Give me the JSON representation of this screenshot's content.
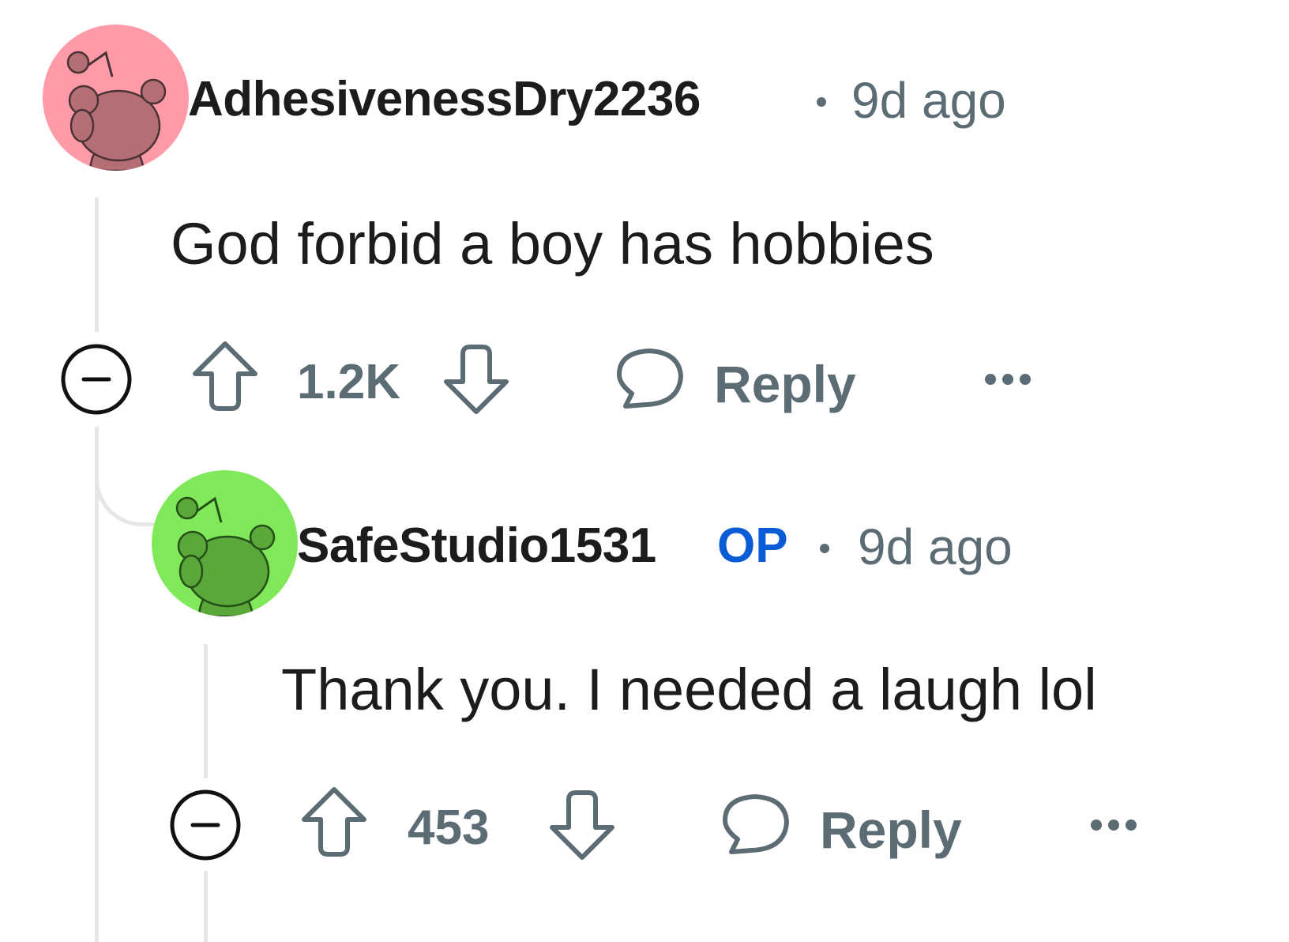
{
  "colors": {
    "text": "#1c1c1c",
    "meta": "#5c6c74",
    "op_badge": "#0a5cd6",
    "thread_line": "#e4e6e8",
    "avatar1_bg": "#ff9aa8",
    "avatar1_snoo": "#b56f74",
    "avatar2_bg": "#80e95a",
    "avatar2_snoo": "#5aa83a"
  },
  "comments": [
    {
      "username": "AdhesivenessDry2236",
      "time": "9d ago",
      "body": "God forbid a boy has hobbies",
      "score": "1.2K",
      "reply_label": "Reply",
      "avatar_icon": "snoo-avatar-icon"
    },
    {
      "username": "SafeStudio1531",
      "badge": "OP",
      "time": "9d ago",
      "body": "Thank you. I needed a laugh lol",
      "score": "453",
      "reply_label": "Reply",
      "avatar_icon": "snoo-avatar-icon"
    }
  ]
}
